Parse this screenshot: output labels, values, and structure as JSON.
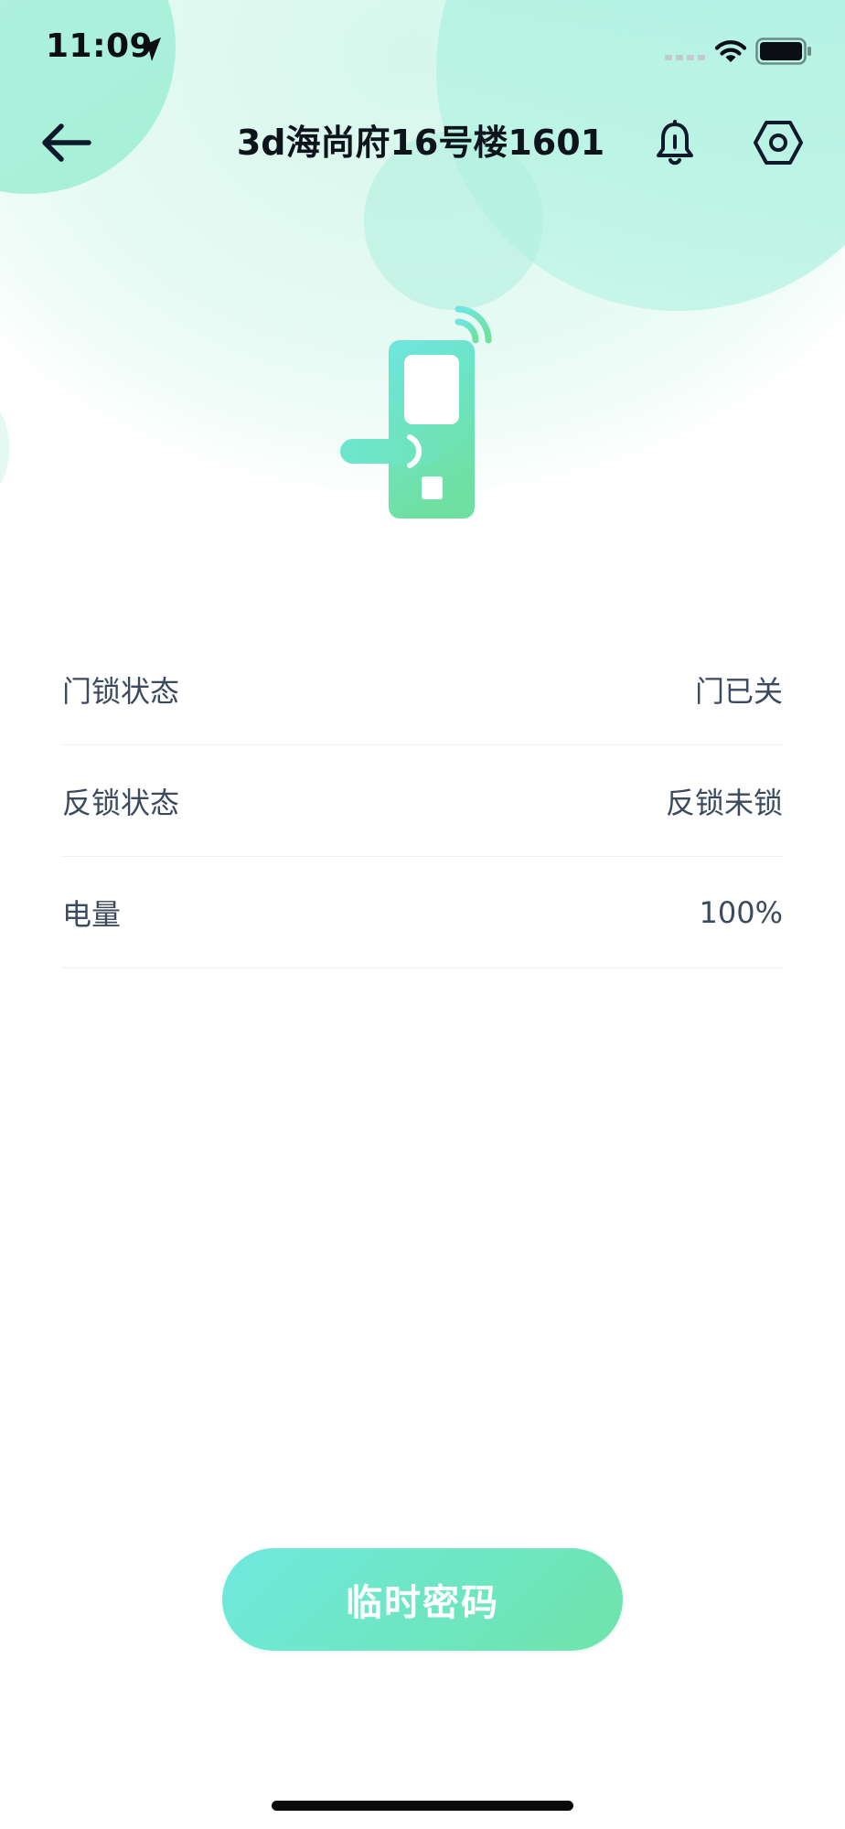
{
  "status_bar": {
    "time": "11:09",
    "icons": [
      "location-arrow-icon",
      "cellular-signal-icon",
      "wifi-icon",
      "battery-icon"
    ]
  },
  "nav": {
    "title": "3d海尚府16号楼1601",
    "icons": [
      "back-arrow-icon",
      "bell-icon",
      "settings-hexagon-icon"
    ]
  },
  "illustration": {
    "icon": "smart-door-lock-icon"
  },
  "info": {
    "rows": [
      {
        "label": "门锁状态",
        "value": "门已关"
      },
      {
        "label": "反锁状态",
        "value": "反锁未锁"
      },
      {
        "label": "电量",
        "value": "100%"
      }
    ]
  },
  "actions": {
    "temp_password_label": "临时密码"
  },
  "colors": {
    "accent_start": "#6fe9df",
    "accent_end": "#6fe3a8",
    "background_bubbles": "#a6f0dd",
    "label_text": "#3c4a5f",
    "title_text": "#0e141b"
  }
}
